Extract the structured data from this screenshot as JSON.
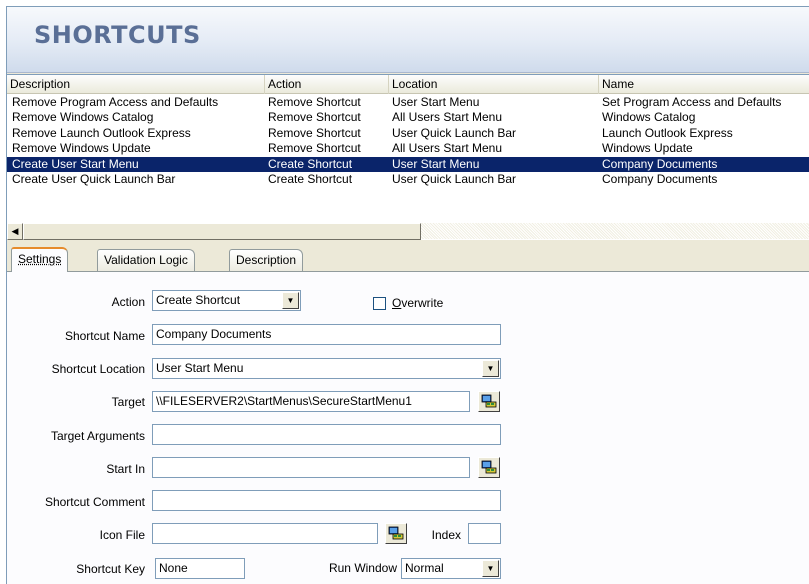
{
  "banner": {
    "title": "SHORTCUTS"
  },
  "list": {
    "columns": [
      "Description",
      "Action",
      "Location",
      "Name"
    ],
    "rows": [
      [
        "Remove Program Access and Defaults",
        "Remove Shortcut",
        "User Start Menu",
        "Set Program Access and Defaults"
      ],
      [
        "Remove Windows Catalog",
        "Remove Shortcut",
        "All Users Start Menu",
        "Windows Catalog"
      ],
      [
        "Remove Launch Outlook Express",
        "Remove Shortcut",
        "User Quick Launch Bar",
        "Launch Outlook Express"
      ],
      [
        "Remove Windows Update",
        "Remove Shortcut",
        "All Users Start Menu",
        "Windows Update"
      ],
      [
        "Create User Start Menu",
        "Create Shortcut",
        "User Start Menu",
        "Company Documents"
      ],
      [
        "Create User Quick Launch Bar",
        "Create Shortcut",
        "User Quick Launch Bar",
        "Company Documents"
      ]
    ],
    "selected_row": 4
  },
  "tabs": [
    {
      "label": "Settings",
      "active": true
    },
    {
      "label": "Validation Logic",
      "active": false
    },
    {
      "label": "Description",
      "active": false
    }
  ],
  "form": {
    "action": {
      "label": "Action",
      "value": "Create Shortcut"
    },
    "overwrite": {
      "label": "Overwrite",
      "checked": false
    },
    "shortcut_name": {
      "label": "Shortcut Name",
      "value": "Company Documents"
    },
    "shortcut_location": {
      "label": "Shortcut Location",
      "value": "User Start Menu"
    },
    "target": {
      "label": "Target",
      "value": "\\\\FILESERVER2\\StartMenus\\SecureStartMenu1"
    },
    "target_arguments": {
      "label": "Target Arguments",
      "value": ""
    },
    "start_in": {
      "label": "Start In",
      "value": ""
    },
    "shortcut_comment": {
      "label": "Shortcut Comment",
      "value": ""
    },
    "icon_file": {
      "label": "Icon File",
      "value": ""
    },
    "index": {
      "label": "Index",
      "value": ""
    },
    "shortcut_key": {
      "label": "Shortcut Key",
      "value": "None"
    },
    "run_window": {
      "label": "Run Window",
      "value": "Normal"
    }
  },
  "icons": {
    "browse": "browse-folder-icon",
    "dropdown": "dropdown-arrow-icon",
    "scroll_left": "scroll-left-arrow-icon"
  },
  "colors": {
    "selection": "#0a246a",
    "banner_text": "#5a6f96",
    "active_tab_accent": "#e68b2c"
  }
}
